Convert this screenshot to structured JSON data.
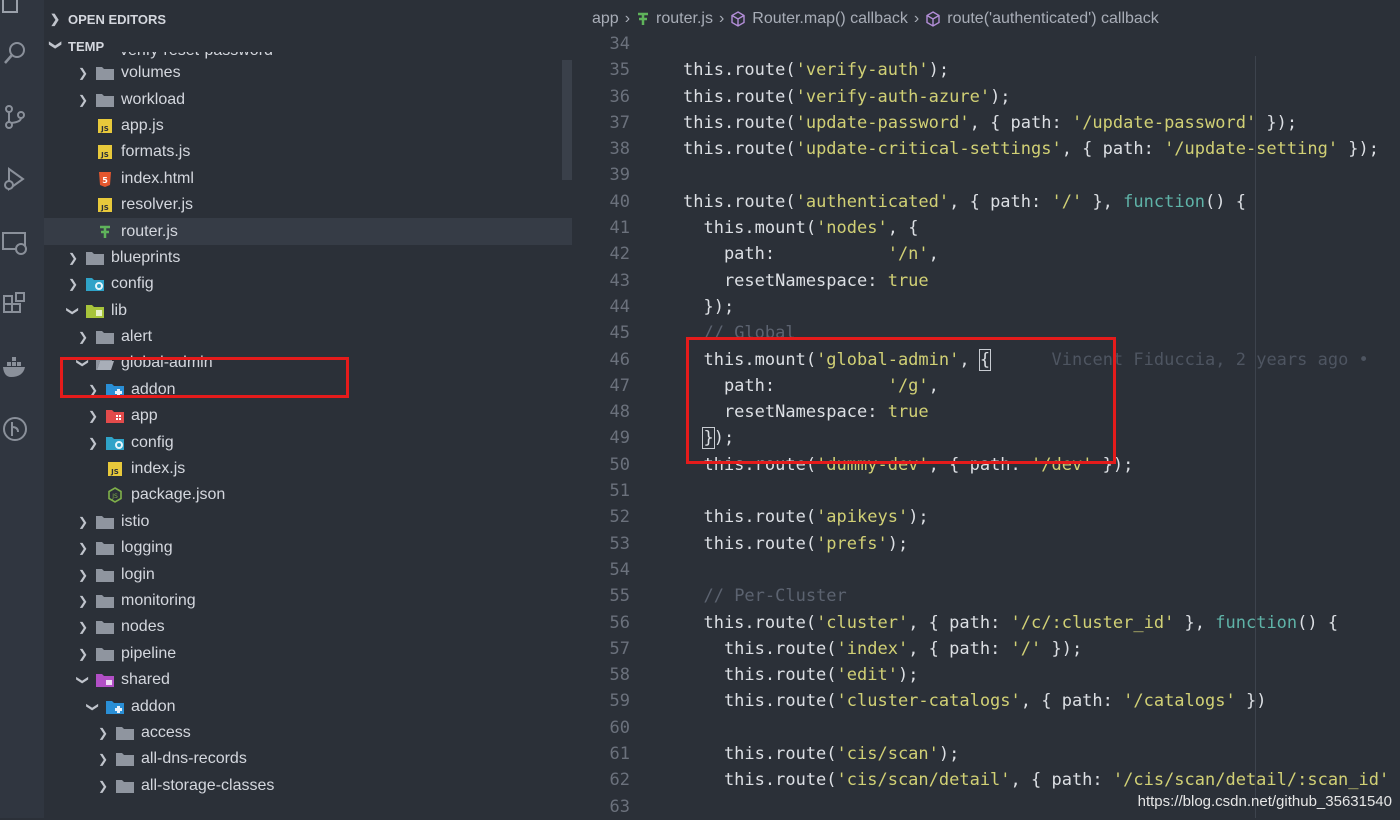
{
  "sidebar": {
    "sections": {
      "open_editors": "OPEN EDITORS",
      "temp": "TEMP"
    },
    "partial_item": "verify-reset-password",
    "items": [
      {
        "label": "volumes",
        "type": "folder",
        "expanded": false
      },
      {
        "label": "workload",
        "type": "folder",
        "expanded": false
      },
      {
        "label": "app.js",
        "type": "js"
      },
      {
        "label": "formats.js",
        "type": "js"
      },
      {
        "label": "index.html",
        "type": "html"
      },
      {
        "label": "resolver.js",
        "type": "js"
      },
      {
        "label": "router.js",
        "type": "router"
      },
      {
        "label": "blueprints",
        "type": "folder",
        "expanded": false
      },
      {
        "label": "config",
        "type": "config-folder",
        "expanded": false
      },
      {
        "label": "lib",
        "type": "lib-folder",
        "expanded": true
      },
      {
        "label": "alert",
        "type": "folder",
        "expanded": false
      },
      {
        "label": "global-admin",
        "type": "open-folder",
        "expanded": true
      },
      {
        "label": "addon",
        "type": "addon-folder",
        "expanded": false
      },
      {
        "label": "app",
        "type": "app-folder",
        "expanded": false
      },
      {
        "label": "config",
        "type": "config-folder",
        "expanded": false
      },
      {
        "label": "index.js",
        "type": "js"
      },
      {
        "label": "package.json",
        "type": "node"
      },
      {
        "label": "istio",
        "type": "folder",
        "expanded": false
      },
      {
        "label": "logging",
        "type": "folder",
        "expanded": false
      },
      {
        "label": "login",
        "type": "folder",
        "expanded": false
      },
      {
        "label": "monitoring",
        "type": "folder",
        "expanded": false
      },
      {
        "label": "nodes",
        "type": "folder",
        "expanded": false
      },
      {
        "label": "pipeline",
        "type": "folder",
        "expanded": false
      },
      {
        "label": "shared",
        "type": "shared-folder",
        "expanded": true
      },
      {
        "label": "addon",
        "type": "addon-folder",
        "expanded": true
      },
      {
        "label": "access",
        "type": "folder",
        "expanded": false
      },
      {
        "label": "all-dns-records",
        "type": "folder",
        "expanded": false
      },
      {
        "label": "all-storage-classes",
        "type": "folder",
        "expanded": false
      }
    ]
  },
  "breadcrumb": {
    "items": [
      "app",
      "router.js",
      "Router.map() callback",
      "route('authenticated') callback"
    ]
  },
  "code": {
    "lines": [
      {
        "n": "34",
        "html": ""
      },
      {
        "n": "35",
        "html": "this.route(<span class=\"s\">'verify-auth'</span>);"
      },
      {
        "n": "36",
        "html": "this.route(<span class=\"s\">'verify-auth-azure'</span>);"
      },
      {
        "n": "37",
        "html": "this.route(<span class=\"s\">'update-password'</span>, { path: <span class=\"s\">'/update-password'</span> });"
      },
      {
        "n": "38",
        "html": "this.route(<span class=\"s\">'update-critical-settings'</span>, { path: <span class=\"s\">'/update-setting'</span> });"
      },
      {
        "n": "39",
        "html": ""
      },
      {
        "n": "40",
        "html": "this.route(<span class=\"s\">'authenticated'</span>, { path: <span class=\"s\">'/'</span> }, <span class=\"k\">function</span>() {"
      },
      {
        "n": "41",
        "html": "  this.mount(<span class=\"s\">'nodes'</span>, {"
      },
      {
        "n": "42",
        "html": "    path:           <span class=\"s\">'/n'</span>,"
      },
      {
        "n": "43",
        "html": "    resetNamespace: <span class=\"s\">true</span>"
      },
      {
        "n": "44",
        "html": "  });"
      },
      {
        "n": "45",
        "html": "  <span class=\"c\">// Global</span>"
      },
      {
        "n": "46",
        "html": "  this.mount(<span class=\"s\">'global-admin'</span>, <span class=\"cursor-b\">{</span>      <span class=\"blame\">Vincent Fiduccia, 2 years ago •</span>"
      },
      {
        "n": "47",
        "html": "    path:           <span class=\"s\">'/g'</span>,"
      },
      {
        "n": "48",
        "html": "    resetNamespace: <span class=\"s\">true</span>"
      },
      {
        "n": "49",
        "html": "  <span class=\"cursor-b\">}</span>);"
      },
      {
        "n": "50",
        "html": "  this.route(<span class=\"s\">'dummy-dev'</span>, { path: <span class=\"s\">'/dev'</span> });"
      },
      {
        "n": "51",
        "html": ""
      },
      {
        "n": "52",
        "html": "  this.route(<span class=\"s\">'apikeys'</span>);"
      },
      {
        "n": "53",
        "html": "  this.route(<span class=\"s\">'prefs'</span>);"
      },
      {
        "n": "54",
        "html": ""
      },
      {
        "n": "55",
        "html": "  <span class=\"c\">// Per-Cluster</span>"
      },
      {
        "n": "56",
        "html": "  this.route(<span class=\"s\">'cluster'</span>, { path: <span class=\"s\">'/c/:cluster_id'</span> }, <span class=\"k\">function</span>() {"
      },
      {
        "n": "57",
        "html": "    this.route(<span class=\"s\">'index'</span>, { path: <span class=\"s\">'/'</span> });"
      },
      {
        "n": "58",
        "html": "    this.route(<span class=\"s\">'edit'</span>);"
      },
      {
        "n": "59",
        "html": "    this.route(<span class=\"s\">'cluster-catalogs'</span>, { path: <span class=\"s\">'/catalogs'</span> })"
      },
      {
        "n": "60",
        "html": ""
      },
      {
        "n": "61",
        "html": "    this.route(<span class=\"s\">'cis/scan'</span>);"
      },
      {
        "n": "62",
        "html": "    this.route(<span class=\"s\">'cis/scan/detail'</span>, { path: <span class=\"s\">'/cis/scan/detail/:scan_id'</span>"
      },
      {
        "n": "63",
        "html": ""
      }
    ]
  },
  "watermark": "https://blog.csdn.net/github_35631540",
  "colors": {
    "highlight_box": "#e51b1b",
    "string": "#d1d075",
    "keyword": "#5fb3a8"
  }
}
